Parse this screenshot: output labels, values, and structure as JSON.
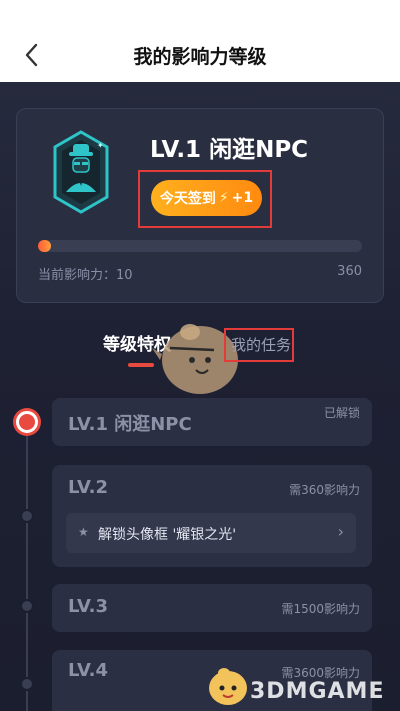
{
  "header": {
    "title": "我的影响力等级"
  },
  "profile": {
    "level_title": "LV.1 闲逛NPC",
    "checkin_label": "今天签到",
    "checkin_bonus": "+1",
    "progress_label": "当前影响力：10",
    "progress_max": "360",
    "progress_value": 10,
    "progress_total": 360
  },
  "tabs": [
    {
      "label": "等级特权"
    },
    {
      "label": "我的任务"
    }
  ],
  "levels": [
    {
      "name": "LV.1 闲逛NPC",
      "status": "已解锁"
    },
    {
      "name": "LV.2",
      "requirement": "需360影响力",
      "reward": "解锁头像框 '耀银之光'"
    },
    {
      "name": "LV.3",
      "requirement": "需1500影响力"
    },
    {
      "name": "LV.4",
      "requirement": "需3600影响力"
    }
  ],
  "watermark": {
    "text": "3DMGAME"
  },
  "colors": {
    "accent": "#e84a3f",
    "button": "#ff9a16",
    "highlight": "#e33a3a"
  }
}
